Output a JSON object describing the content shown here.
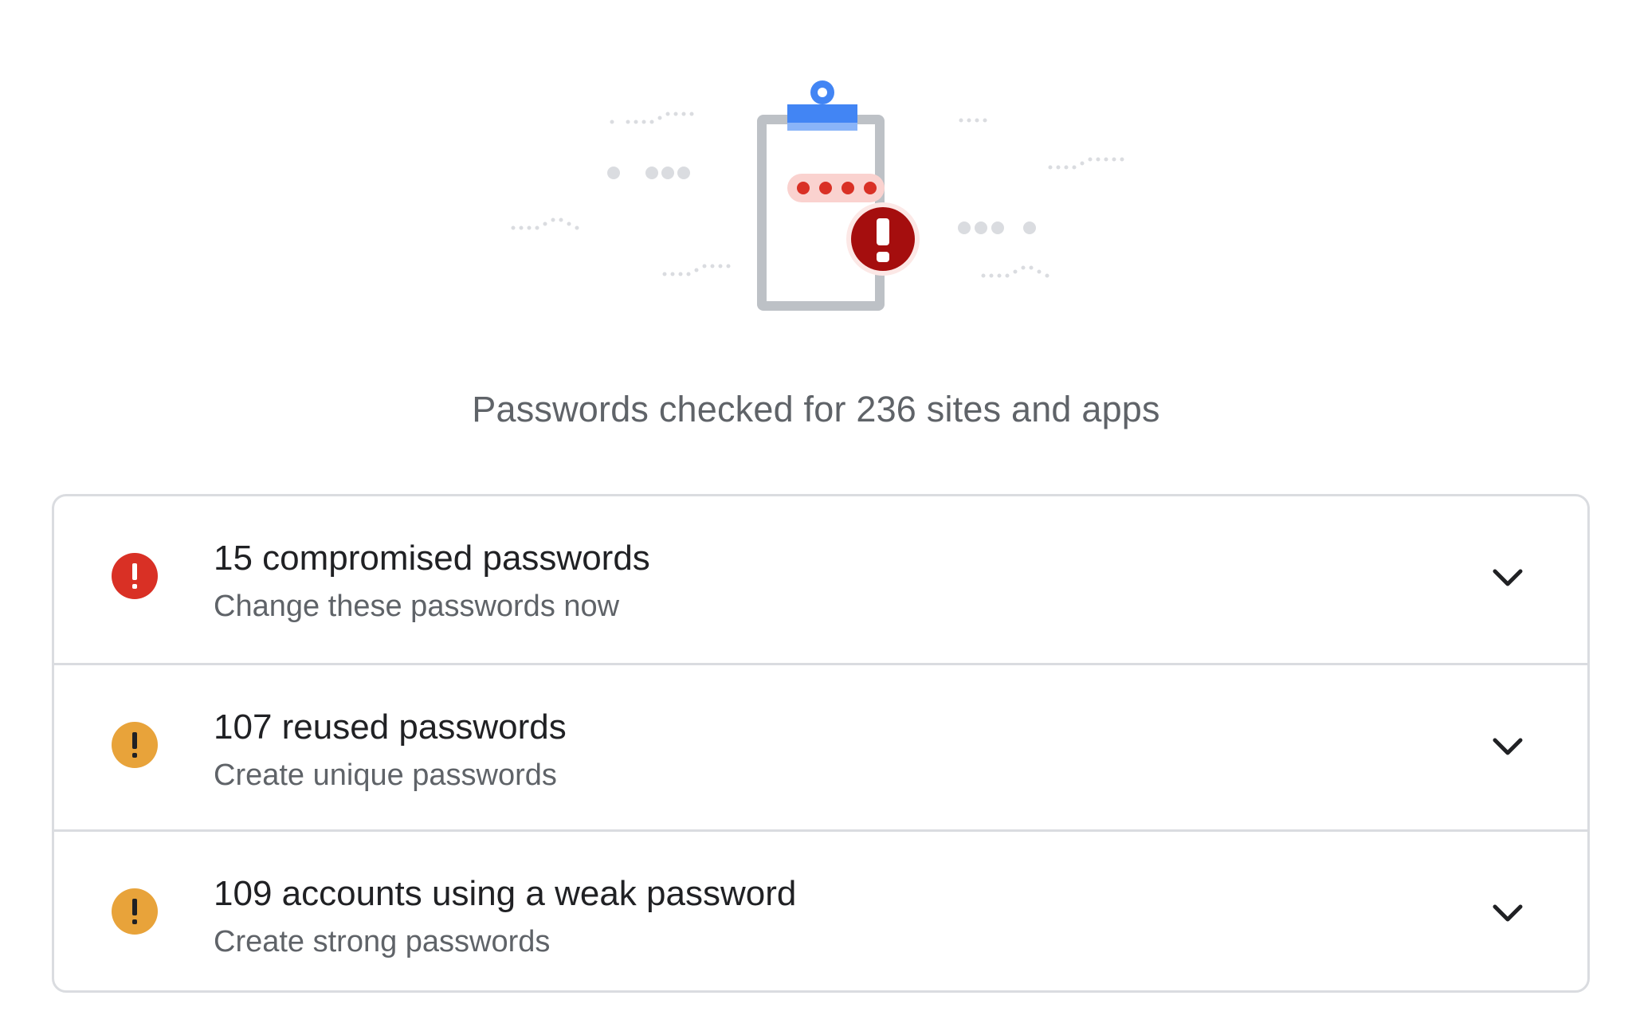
{
  "summary": {
    "text": "Passwords checked for 236 sites and apps"
  },
  "illustration": {
    "name": "clipboard-password-warning",
    "masked_dots": "••••",
    "colors": {
      "clip_blue": "#4285f4",
      "board_gray": "#bdc1c6",
      "dot_red": "#d93025",
      "badge_red": "#a50e0e",
      "confetti_gray": "#dadce0"
    }
  },
  "issues": [
    {
      "title": "15 compromised passwords",
      "subtitle": "Change these passwords now",
      "icon": "error-icon",
      "color": "#d93025"
    },
    {
      "title": "107 reused passwords",
      "subtitle": "Create unique passwords",
      "icon": "warning-icon",
      "color": "#e8a33a"
    },
    {
      "title": "109 accounts using a weak password",
      "subtitle": "Create strong passwords",
      "icon": "warning-icon",
      "color": "#e8a33a"
    }
  ],
  "expand_icon": "chevron-down-icon"
}
